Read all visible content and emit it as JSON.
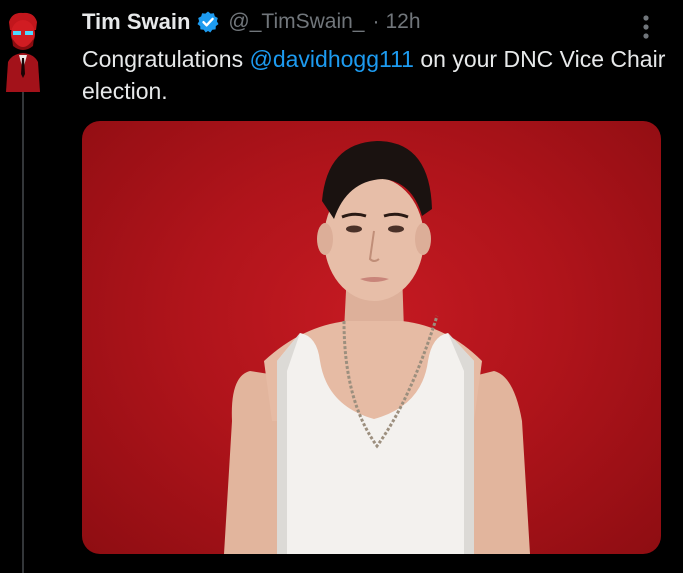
{
  "tweet": {
    "author": {
      "display_name": "Tim Swain",
      "handle": "@_TimSwain_",
      "verified": true,
      "avatar_icon": "red-figure-avatar-icon"
    },
    "separator": "·",
    "timestamp": "12h",
    "text": {
      "before": "Congratulations ",
      "mention": "@davidhogg111",
      "after": " on your DNC Vice Chair election."
    },
    "media": {
      "type": "photo",
      "background_color": "#b5151c"
    },
    "more_icon": "vertical-ellipsis-icon"
  },
  "colors": {
    "background": "#000000",
    "text_primary": "#e7e9ea",
    "text_secondary": "#71767b",
    "link": "#1d9bf0",
    "verified": "#1d9bf0",
    "thread_line": "#333639"
  }
}
